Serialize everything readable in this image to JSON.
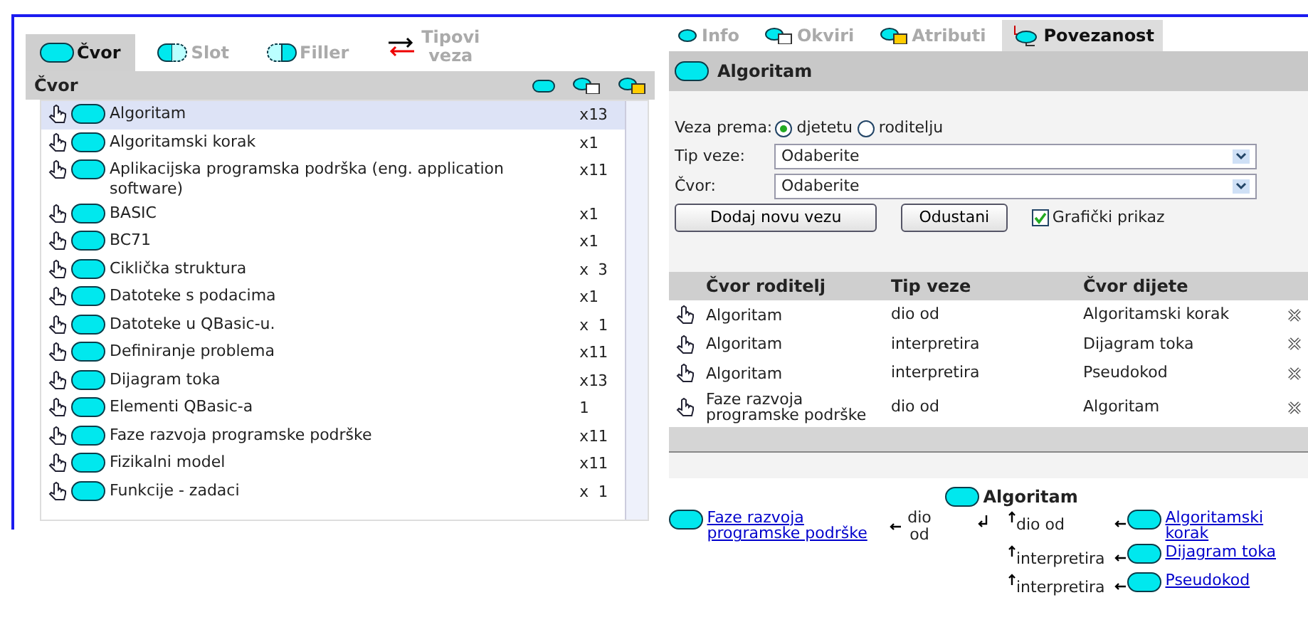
{
  "left_tabs": [
    {
      "label": "Čvor",
      "kind": "node",
      "selected": true
    },
    {
      "label": "Slot",
      "kind": "slot",
      "selected": false
    },
    {
      "label": "Filler",
      "kind": "filler",
      "selected": false
    },
    {
      "label": "Tipovi veza",
      "kind": "links",
      "selected": false
    }
  ],
  "node_list": {
    "header": "Čvor",
    "rows": [
      {
        "name": "Algoritam",
        "count": "x13",
        "selected": true
      },
      {
        "name": "Algoritamski korak",
        "count": "x1",
        "selected": false
      },
      {
        "name": "Aplikacijska programska podrška (eng. application software)",
        "count": "x11",
        "selected": false
      },
      {
        "name": "BASIC",
        "count": "x1",
        "selected": false
      },
      {
        "name": "BC71",
        "count": "x1",
        "selected": false
      },
      {
        "name": "Ciklička struktura",
        "count": "x 3",
        "selected": false
      },
      {
        "name": "Datoteke s podacima",
        "count": "x1",
        "selected": false
      },
      {
        "name": "Datoteke u QBasic-u.",
        "count": "x 1",
        "selected": false
      },
      {
        "name": "Definiranje problema",
        "count": "x11",
        "selected": false
      },
      {
        "name": "Dijagram toka",
        "count": "x13",
        "selected": false
      },
      {
        "name": "Elementi QBasic-a",
        "count": "1",
        "selected": false
      },
      {
        "name": "Faze razvoja programske podrške",
        "count": "x11",
        "selected": false
      },
      {
        "name": "Fizikalni model",
        "count": "x11",
        "selected": false
      },
      {
        "name": "Funkcije - zadaci",
        "count": "x 1",
        "selected": false
      }
    ]
  },
  "right_tabs": [
    {
      "label": "Info",
      "kind": "info",
      "selected": false
    },
    {
      "label": "Okviri",
      "kind": "frames",
      "selected": false
    },
    {
      "label": "Atributi",
      "kind": "attributes",
      "selected": false
    },
    {
      "label": "Povezanost",
      "kind": "links",
      "selected": true
    }
  ],
  "node_title": "Algoritam",
  "form": {
    "direction_label": "Veza prema:",
    "directions": [
      {
        "label": "djetetu",
        "selected": true
      },
      {
        "label": "roditelju",
        "selected": false
      }
    ],
    "fields": [
      {
        "label": "Tip veze:",
        "value": "Odaberite"
      },
      {
        "label": "Čvor:",
        "value": "Odaberite"
      }
    ],
    "buttons": [
      "Dodaj novu vezu",
      "Odustani"
    ],
    "graphic": {
      "label": "Grafički prikaz",
      "checked": true
    }
  },
  "links_table": {
    "columns": [
      "Čvor roditelj",
      "Tip veze",
      "Čvor dijete"
    ],
    "rows": [
      [
        "Algoritam",
        "dio od",
        "Algoritamski korak"
      ],
      [
        "Algoritam",
        "interpretira",
        "Dijagram toka"
      ],
      [
        "Algoritam",
        "interpretira",
        "Pseudokod"
      ],
      [
        "Faze razvoja programske podrške",
        "dio od",
        "Algoritam"
      ]
    ]
  },
  "graph": {
    "center": "Algoritam",
    "parents": [
      {
        "node": "Faze razvoja programske podrške",
        "relation": "dio od"
      }
    ],
    "children": [
      {
        "relation": "dio od",
        "node": "Algoritamski korak"
      },
      {
        "relation": "interpretira",
        "node": "Dijagram toka"
      },
      {
        "relation": "interpretira",
        "node": "Pseudokod"
      }
    ]
  }
}
